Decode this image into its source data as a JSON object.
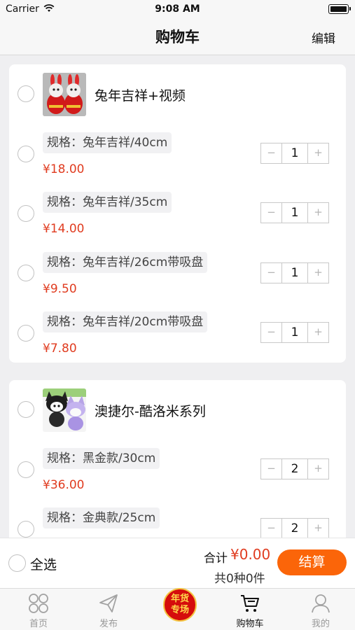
{
  "status_bar": {
    "carrier": "Carrier",
    "time": "9:08 AM"
  },
  "nav": {
    "title": "购物车",
    "edit_label": "编辑"
  },
  "shops": [
    {
      "product_name": "兔年吉祥+视频",
      "skus": [
        {
          "spec": "规格：兔年吉祥/40cm",
          "price": "¥18.00",
          "quantity": "1"
        },
        {
          "spec": "规格：兔年吉祥/35cm",
          "price": "¥14.00",
          "quantity": "1"
        },
        {
          "spec": "规格：兔年吉祥/26cm带吸盘",
          "price": "¥9.50",
          "quantity": "1"
        },
        {
          "spec": "规格：兔年吉祥/20cm带吸盘",
          "price": "¥7.80",
          "quantity": "1"
        }
      ]
    },
    {
      "product_name": "澳捷尔-酷洛米系列",
      "skus": [
        {
          "spec": "规格：黑金款/30cm",
          "price": "¥36.00",
          "quantity": "2"
        },
        {
          "spec": "规格：金典款/25cm",
          "price": "",
          "quantity": "2"
        }
      ]
    }
  ],
  "stepper": {
    "minus": "−",
    "plus": "+"
  },
  "checkout": {
    "select_all_label": "全选",
    "total_label": "合计",
    "total_value": "¥0.00",
    "count_text": "共0种0件",
    "checkout_label": "结算"
  },
  "tabs": [
    {
      "label": "首页",
      "icon": "home-grid-icon"
    },
    {
      "label": "发布",
      "icon": "paper-plane-icon"
    },
    {
      "label": "年货专场",
      "icon": "promo-badge"
    },
    {
      "label": "购物车",
      "icon": "cart-icon"
    },
    {
      "label": "我的",
      "icon": "user-icon"
    }
  ],
  "promo": {
    "line1": "年货",
    "line2": "专场"
  },
  "colors": {
    "accent": "#fb6509",
    "price": "#e03c20",
    "promo": "#d50c0c"
  }
}
